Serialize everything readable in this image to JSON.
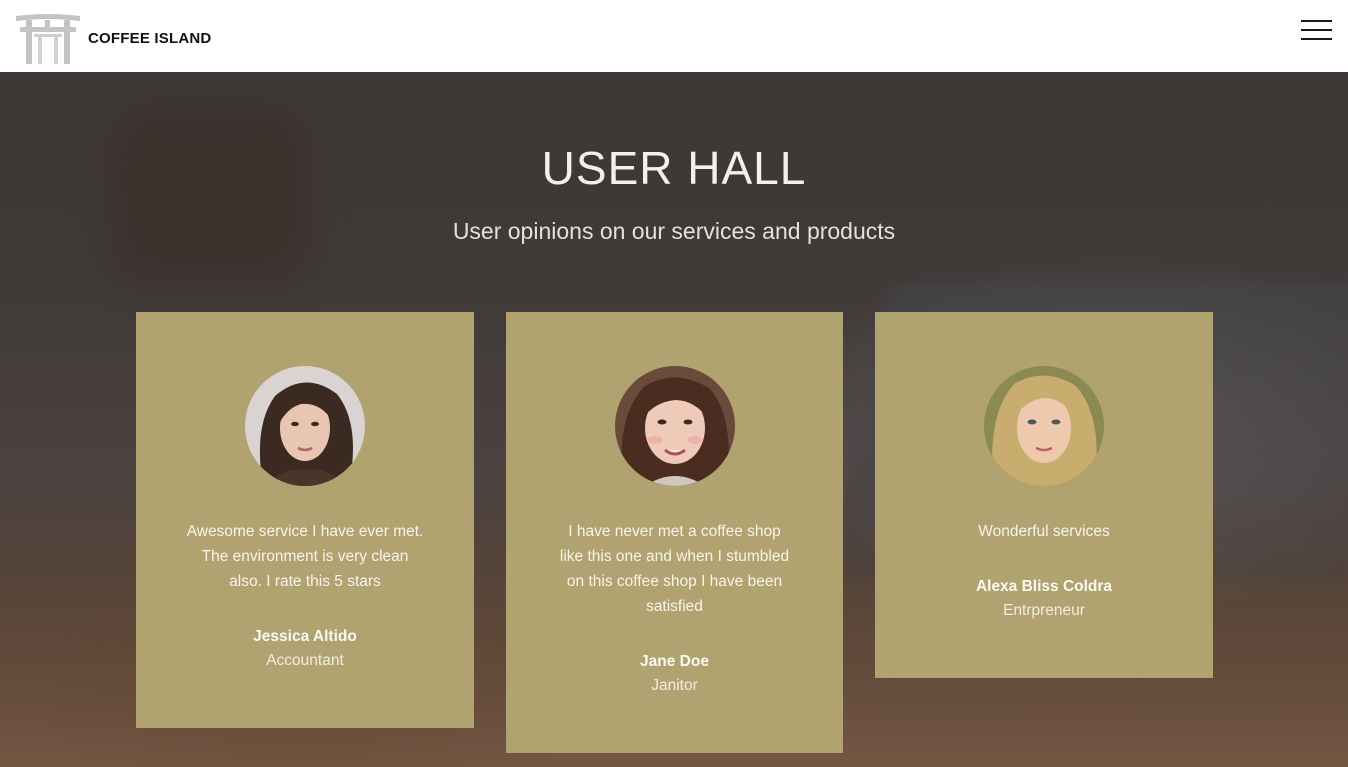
{
  "header": {
    "brand_name": "COFFEE ISLAND",
    "logo_icon": "torii-gate-icon",
    "menu_icon": "hamburger-menu-icon"
  },
  "hero": {
    "title": "USER HALL",
    "subtitle": "User opinions on our services and products"
  },
  "testimonials": [
    {
      "quote": "Awesome service I have ever met. The environment is very clean also. I rate this 5 stars",
      "name": "Jessica Altido",
      "role": "Accountant",
      "avatar": "user-photo-icon"
    },
    {
      "quote": "I have never met a coffee shop like this one and when I stumbled on this coffee shop I have been satisfied",
      "name": "Jane Doe",
      "role": "Janitor",
      "avatar": "user-photo-icon"
    },
    {
      "quote": "Wonderful services",
      "name": "Alexa Bliss Coldra",
      "role": "Entrpreneur",
      "avatar": "user-photo-icon"
    }
  ],
  "colors": {
    "card_background": "#b0a370",
    "header_background": "#ffffff",
    "hero_overlay": "#3d3836"
  }
}
